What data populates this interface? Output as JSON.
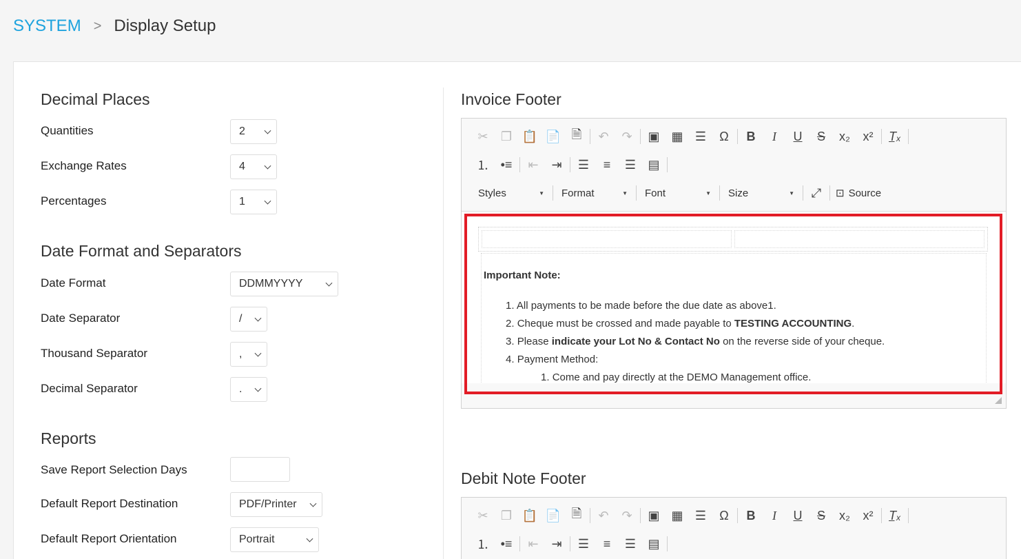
{
  "breadcrumb": {
    "root": "SYSTEM",
    "separator": ">",
    "current": "Display Setup"
  },
  "left": {
    "decimal_places": {
      "title": "Decimal Places",
      "rows": [
        {
          "label": "Quantities",
          "value": "2"
        },
        {
          "label": "Exchange Rates",
          "value": "4"
        },
        {
          "label": "Percentages",
          "value": "1"
        }
      ]
    },
    "date_format": {
      "title": "Date Format and Separators",
      "rows": [
        {
          "label": "Date Format",
          "value": "DDMMYYYY"
        },
        {
          "label": "Date Separator",
          "value": "/"
        },
        {
          "label": "Thousand Separator",
          "value": ","
        },
        {
          "label": "Decimal Separator",
          "value": "."
        }
      ]
    },
    "reports": {
      "title": "Reports",
      "rows": [
        {
          "label": "Save Report Selection Days",
          "value": ""
        },
        {
          "label": "Default Report Destination",
          "value": "PDF/Printer"
        },
        {
          "label": "Default Report Orientation",
          "value": "Portrait"
        }
      ]
    }
  },
  "invoice_footer": {
    "title": "Invoice Footer",
    "toolbar": {
      "styles": "Styles",
      "format": "Format",
      "font": "Font",
      "size": "Size",
      "source": "Source"
    },
    "content": {
      "heading": "Important Note:",
      "items": [
        {
          "num": "1.",
          "text": "All payments to be made before the due date as above1."
        },
        {
          "num": "2.",
          "pre": "Cheque must be crossed and made payable to ",
          "bold": "TESTING ACCOUNTING",
          "post": "."
        },
        {
          "num": "3.",
          "pre": "Please ",
          "bold": "indicate your Lot No & Contact No",
          "post": " on the reverse side of your cheque."
        },
        {
          "num": "4.",
          "text": "Payment Method:"
        }
      ],
      "subitems": [
        {
          "num": "1.",
          "text": "Come and pay directly at the DEMO Management office."
        }
      ]
    }
  },
  "debit_note_footer": {
    "title": "Debit Note Footer"
  },
  "icons": [
    "cut-icon",
    "copy-icon",
    "paste-icon",
    "paste-text-icon",
    "paste-word-icon",
    "undo-icon",
    "redo-icon",
    "image-icon",
    "table-icon",
    "horizontal-line-icon",
    "special-char-icon",
    "bold-icon",
    "italic-icon",
    "underline-icon",
    "strike-icon",
    "subscript-icon",
    "superscript-icon",
    "remove-format-icon",
    "numbered-list-icon",
    "bulleted-list-icon",
    "outdent-icon",
    "indent-icon",
    "align-left-icon",
    "align-center-icon",
    "align-right-icon",
    "justify-icon",
    "maximize-icon",
    "source-icon"
  ],
  "colors": {
    "accent": "#1ea3de",
    "highlight": "#e21c26"
  }
}
